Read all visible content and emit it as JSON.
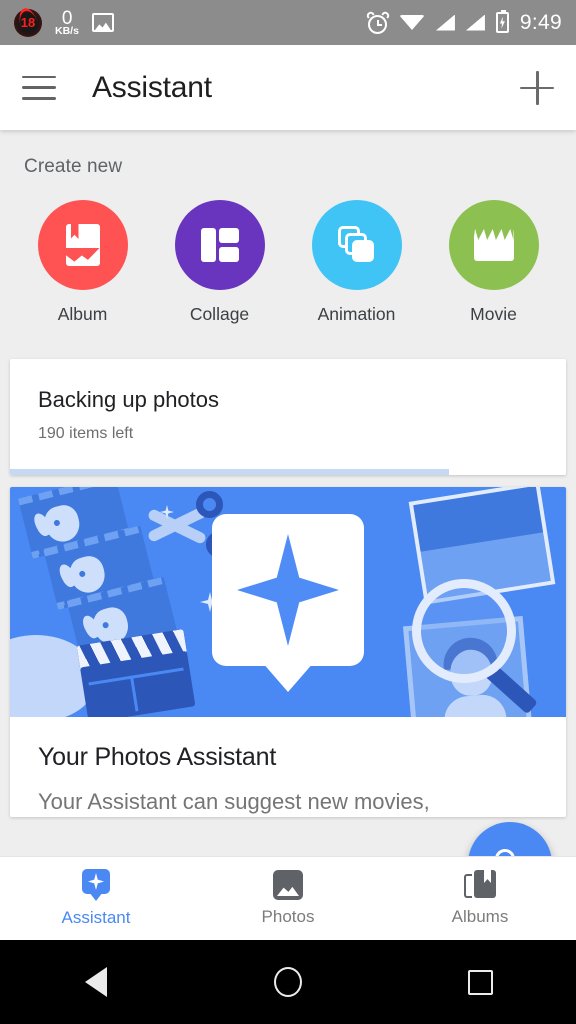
{
  "status_bar": {
    "notification_badge": "18",
    "network_speed_value": "0",
    "network_speed_unit": "KB/s",
    "icons": [
      "photo-icon",
      "alarm-icon",
      "wifi-icon",
      "signal-icon",
      "signal-icon",
      "battery-charging-icon"
    ],
    "time": "9:49",
    "background_color": "#8c8c8c"
  },
  "app_bar": {
    "menu_icon": "hamburger-menu-icon",
    "title": "Assistant",
    "action_icon": "plus-icon"
  },
  "create_new": {
    "section_label": "Create new",
    "items": [
      {
        "label": "Album",
        "icon": "album-icon",
        "color": "#ff5252"
      },
      {
        "label": "Collage",
        "icon": "collage-icon",
        "color": "#6a35be"
      },
      {
        "label": "Animation",
        "icon": "animation-icon",
        "color": "#40c4f5"
      },
      {
        "label": "Movie",
        "icon": "movie-icon",
        "color": "#8cc152"
      }
    ]
  },
  "backup_card": {
    "title": "Backing up photos",
    "subtitle": "190 items left",
    "progress_percent": 79,
    "progress_color": "#c5d9f3"
  },
  "promo_card": {
    "banner_color": "#4a89f3",
    "banner_icon": "assistant-sparkle-bubble-icon",
    "title": "Your Photos Assistant",
    "description": "Your Assistant can suggest new movies,"
  },
  "fab": {
    "icon": "search-icon",
    "color": "#4a89f3"
  },
  "bottom_nav": {
    "items": [
      {
        "label": "Assistant",
        "icon": "assistant-icon",
        "active": true
      },
      {
        "label": "Photos",
        "icon": "photos-icon",
        "active": false
      },
      {
        "label": "Albums",
        "icon": "albums-icon",
        "active": false
      }
    ],
    "active_color": "#4a89f3"
  },
  "system_nav": {
    "back": "back-triangle-icon",
    "home": "home-circle-icon",
    "recents": "recents-square-icon"
  }
}
